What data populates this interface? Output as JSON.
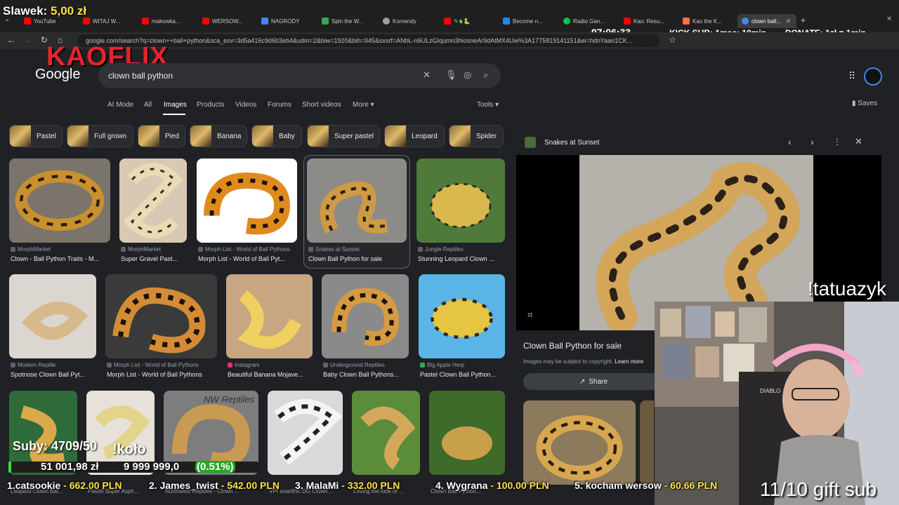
{
  "browser": {
    "tabs": [
      {
        "label": "YouTube",
        "color": "#ff0000"
      },
      {
        "label": "WITAJ W...",
        "color": "#ff0000"
      },
      {
        "label": "makowka...",
        "color": "#ff0000"
      },
      {
        "label": "WERSOW...",
        "color": "#ff0000"
      },
      {
        "label": "NAGRODY",
        "color": "#4285f4"
      },
      {
        "label": "Spin the W...",
        "color": "#34a853"
      },
      {
        "label": "Komendy",
        "color": "#9aa0a6"
      },
      {
        "label": "",
        "color": "#ff0000"
      },
      {
        "label": "Become n...",
        "color": "#1e88e5"
      },
      {
        "label": "Radio Gan...",
        "color": "#00c853"
      },
      {
        "label": "Kao: Resu...",
        "color": "#ff0000"
      },
      {
        "label": "Kao the K...",
        "color": "#ff7043"
      },
      {
        "label": "clown ball...",
        "color": "#4285f4",
        "active": true
      }
    ],
    "url": "google.com/search?q=clown++ball+python&sca_esv=3d5a416c9d6b3eb4&udm=2&biw=1920&bih=945&sxsrf=ANbL-n6ULzGIqumn3hiosneAr9dAtMX4Uw%3A1775819141151&ei=hdnYaan1CK..."
  },
  "stream": {
    "viewer_label": "Slawek:",
    "viewer_amount": "5,00 zł",
    "timer": "97:06:33",
    "separator": "-",
    "kick_sub": "KICK SUB: 1msc: 10min",
    "donate": "DONATE: 1zł = 1min",
    "brand": "KAOFLIX",
    "chat_name": "!tatuazyk",
    "subs": "Suby: 4709/50",
    "command": "!koło",
    "money_total": "51 001,98 zł",
    "money_goal": "9 999 999,0",
    "money_percent": "(0.51%)",
    "gift_sub": "11/10 gift sub",
    "donors": [
      {
        "rank": "1.",
        "name": "catsookie",
        "amount": "- 662.00 PLN"
      },
      {
        "rank": "2.",
        "name": "James_twist",
        "amount": "- 542.00 PLN"
      },
      {
        "rank": "3.",
        "name": "MalaMi",
        "amount": "- 332.00 PLN"
      },
      {
        "rank": "4.",
        "name": "Wygrana",
        "amount": "- 100.00 PLN"
      },
      {
        "rank": "5.",
        "name": "kocham wersow",
        "amount": "- 60.66 PLN"
      }
    ]
  },
  "google": {
    "logo": "Google",
    "query": "clown ball python",
    "saves": "Saves",
    "tools": "Tools",
    "tabs": [
      "AI Mode",
      "All",
      "Images",
      "Products",
      "Videos",
      "Forums",
      "Short videos",
      "More"
    ],
    "active_tab": "Images",
    "chips": [
      "Pastel",
      "Full grown",
      "Pied",
      "Banana",
      "Baby",
      "Super pastel",
      "Leopard",
      "Spider"
    ],
    "results": [
      {
        "source": "MorphMarket",
        "title": "Clown - Ball Python Traits - M..."
      },
      {
        "source": "MorphMarket",
        "title": "Super Gravel Past..."
      },
      {
        "source": "Morph List - World of Ball Pythons",
        "title": "Morph List - World of Ball Pyt..."
      },
      {
        "source": "Snakes at Sunset",
        "title": "Clown Ball Python for sale"
      },
      {
        "source": "Jungle Reptiles",
        "title": "Stunning Leopard Clown ..."
      },
      {
        "source": "Modern Reptile",
        "title": "Spotnose Clown Ball Pyt..."
      },
      {
        "source": "Morph List - World of Ball Pythons",
        "title": "Morph List - World of Ball Pythons"
      },
      {
        "source": "Instagram",
        "title": "Beautiful Banana Mojave..."
      },
      {
        "source": "Underground Reptiles",
        "title": "Baby Clown Ball Pythons..."
      },
      {
        "source": "Big Apple Herp",
        "title": "Pastel Clown Ball Python..."
      }
    ],
    "row3_captions": [
      "Leopard Clown Bal...",
      "Pastel Super Asph...",
      "Northwest Reptiles - Clown ...",
      "VPI axanthic DG Clown...",
      "Loving the look of ...",
      "Clown Ball Python..."
    ],
    "watermark": "NW Reptiles",
    "panel": {
      "source": "Snakes at Sunset",
      "title": "Clown Ball Python for sale",
      "copyright": "Images may be subject to copyright.",
      "learn_more": "Learn more",
      "share": "Share"
    }
  }
}
